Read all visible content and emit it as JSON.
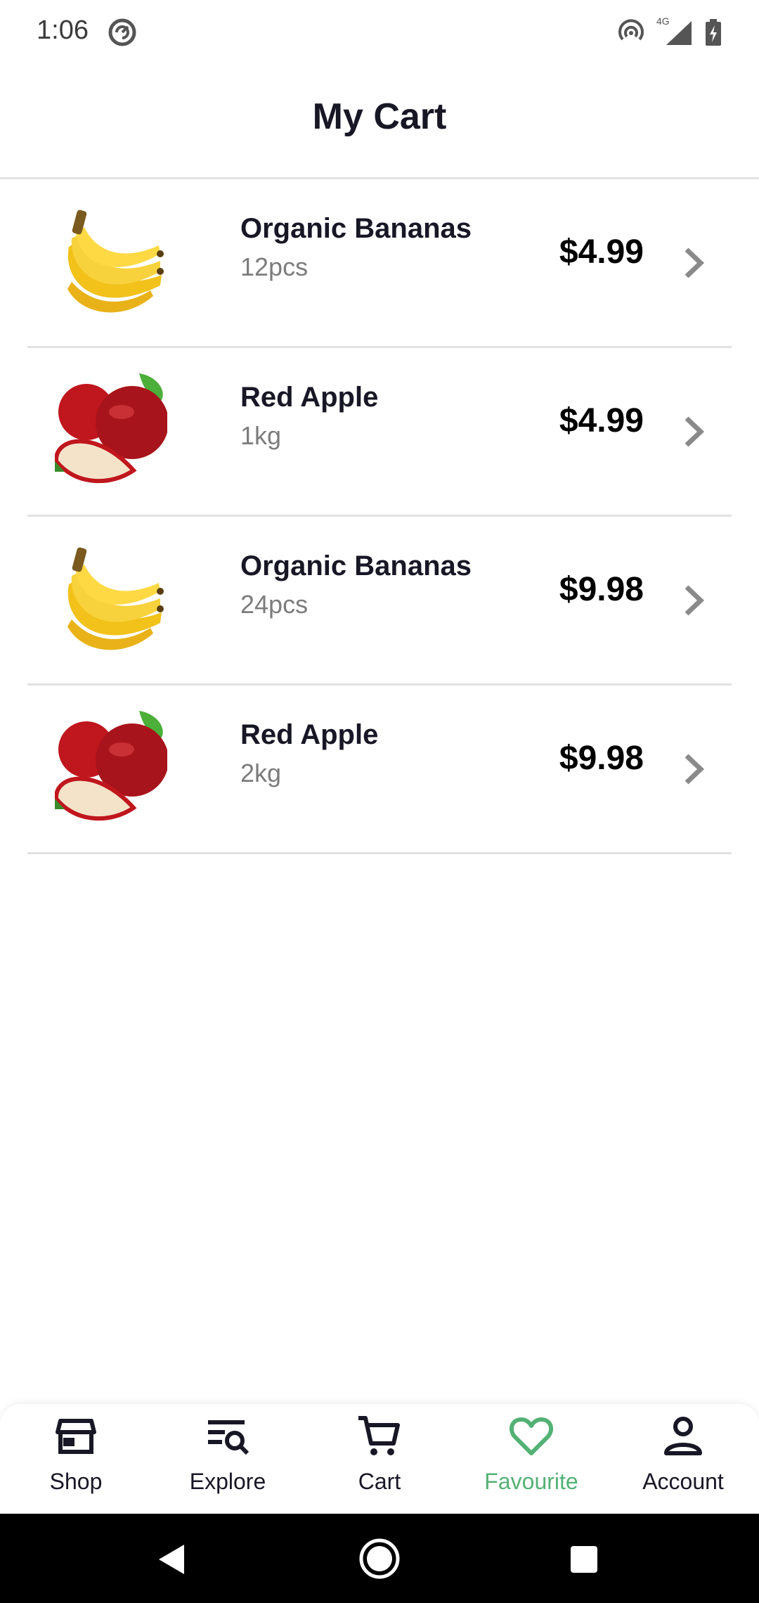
{
  "status_bar": {
    "time": "1:06",
    "network": "4G",
    "icons": [
      "hotspot-icon",
      "signal-icon",
      "battery-charging-icon"
    ]
  },
  "header": {
    "title": "My Cart"
  },
  "cart": {
    "items": [
      {
        "name": "Organic Bananas",
        "quantity": "12pcs",
        "price": "$4.99",
        "image": "banana-image"
      },
      {
        "name": "Red Apple",
        "quantity": "1kg",
        "price": "$4.99",
        "image": "apple-image"
      },
      {
        "name": "Organic Bananas",
        "quantity": "24pcs",
        "price": "$9.98",
        "image": "banana-image"
      },
      {
        "name": "Red Apple",
        "quantity": "2kg",
        "price": "$9.98",
        "image": "apple-image"
      }
    ]
  },
  "bottom_nav": {
    "items": [
      {
        "label": "Shop",
        "icon": "store-icon",
        "active": false
      },
      {
        "label": "Explore",
        "icon": "explore-search-icon",
        "active": false
      },
      {
        "label": "Cart",
        "icon": "cart-icon",
        "active": false
      },
      {
        "label": "Favourite",
        "icon": "heart-icon",
        "active": true
      },
      {
        "label": "Account",
        "icon": "person-icon",
        "active": false
      }
    ]
  },
  "colors": {
    "accent": "#53b175",
    "text_primary": "#181725",
    "text_secondary": "#7c7c7c",
    "divider": "#e2e2e2"
  }
}
